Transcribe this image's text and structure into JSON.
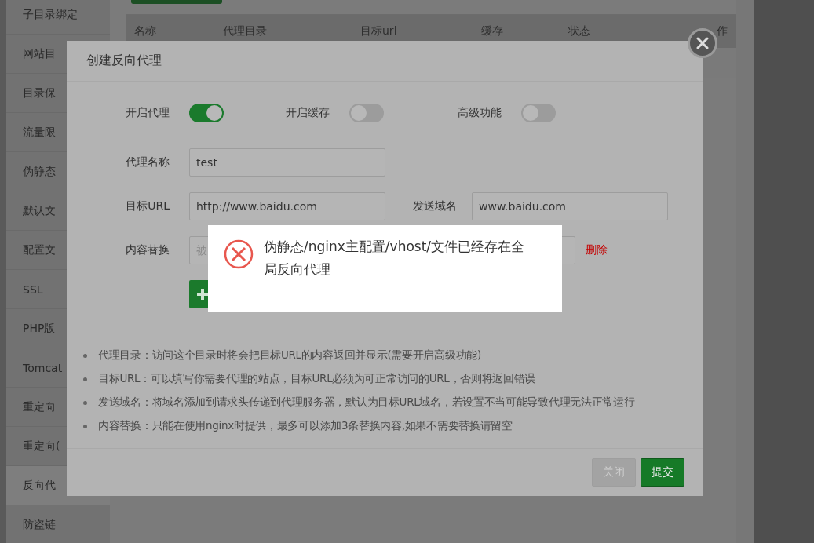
{
  "sidebar": {
    "items": [
      {
        "label": "子目录绑定",
        "selected": false
      },
      {
        "label": "网站目",
        "selected": false
      },
      {
        "label": "目录保",
        "selected": false
      },
      {
        "label": "流量限",
        "selected": false
      },
      {
        "label": "伪静态",
        "selected": false
      },
      {
        "label": "默认文",
        "selected": false
      },
      {
        "label": "配置文",
        "selected": false
      },
      {
        "label": "SSL",
        "selected": false
      },
      {
        "label": "PHP版",
        "selected": false
      },
      {
        "label": "Tomcat",
        "selected": false
      },
      {
        "label": "重定向",
        "selected": false
      },
      {
        "label": "重定向(",
        "selected": false
      },
      {
        "label": "反向代",
        "selected": true
      },
      {
        "label": "防盗链",
        "selected": false
      }
    ]
  },
  "table": {
    "columns": [
      "名称",
      "代理目录",
      "目标url",
      "缓存",
      "状态",
      "作"
    ]
  },
  "dialog": {
    "title": "创建反向代理",
    "switches": [
      {
        "label": "开启代理",
        "on": true
      },
      {
        "label": "开启缓存",
        "on": false
      },
      {
        "label": "高级功能",
        "on": false
      }
    ],
    "fields": [
      {
        "label": "代理名称",
        "value": "test"
      },
      {
        "label": "目标URL",
        "value": "http://www.baidu.com"
      },
      {
        "label": "发送域名",
        "value": "www.baidu.com"
      }
    ],
    "replace": {
      "label": "内容替换",
      "placeholder": "被",
      "delete": "删除"
    },
    "notes": [
      "代理目录：访问这个目录时将会把目标URL的内容返回并显示(需要开启高级功能)",
      "目标URL：可以填写你需要代理的站点，目标URL必须为可正常访问的URL，否则将返回错误",
      "发送域名：将域名添加到请求头传递到代理服务器，默认为目标URL域名，若设置不当可能导致代理无法正常运行",
      "内容替换：只能在使用nginx时提供，最多可以添加3条替换内容,如果不需要替换请留空"
    ],
    "buttons": [
      {
        "label": "关闭",
        "kind": "secondary"
      },
      {
        "label": "提交",
        "kind": "primary"
      }
    ]
  },
  "alert": {
    "message": "伪静态/nginx主配置/vhost/文件已经存在全局反向代理"
  }
}
